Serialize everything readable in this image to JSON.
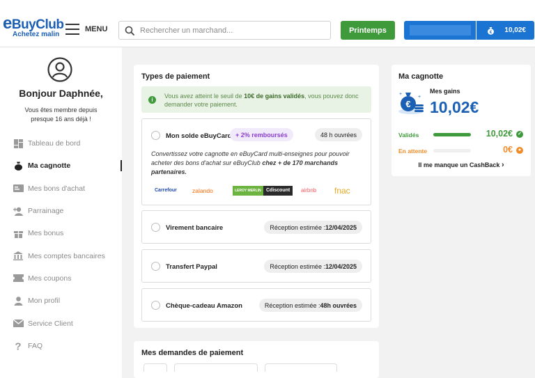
{
  "colors": {
    "brand": "#1b5fb5",
    "green": "#3f9a3c",
    "orange": "#f08c2a",
    "purple": "#8a3fd1"
  },
  "header": {
    "logo_main": "BuyClub",
    "logo_e": "e",
    "logo_tagline": "Achetez malin",
    "menu_label": "MENU",
    "search_placeholder": "Rechercher un marchand...",
    "promo_button": "Printemps",
    "balance": "10,02€"
  },
  "sidebar": {
    "greeting": "Bonjour Daphnée,",
    "member_text": "Vous êtes membre depuis presque 16 ans déjà !",
    "items": [
      {
        "label": "Tableau de bord",
        "icon": "dashboard-icon"
      },
      {
        "label": "Ma cagnotte",
        "icon": "money-bag-icon"
      },
      {
        "label": "Mes bons d'achat",
        "icon": "voucher-icon"
      },
      {
        "label": "Parrainage",
        "icon": "add-user-icon"
      },
      {
        "label": "Mes bonus",
        "icon": "gift-icon"
      },
      {
        "label": "Mes comptes bancaires",
        "icon": "bank-icon"
      },
      {
        "label": "Mes coupons",
        "icon": "coupon-icon"
      },
      {
        "label": "Mon profil",
        "icon": "user-icon"
      },
      {
        "label": "Service Client",
        "icon": "mail-icon"
      },
      {
        "label": "FAQ",
        "icon": "question-icon"
      }
    ],
    "active_index": 1
  },
  "payment": {
    "title": "Types de paiement",
    "info_pre": "Vous avez atteint le seuil de ",
    "info_bold": "10€ de gains validés",
    "info_post": ", vous pouvez donc demander votre paiement.",
    "options": [
      {
        "label": "Mon solde eBuyCard",
        "badge": "+ 2% remboursés",
        "pill": "48 h ouvrées",
        "desc_pre": "Convertissez votre cagnotte en eBuyCard multi-enseignes pour pouvoir acheter des bons d'achat sur eBuyClub ",
        "desc_bold": "chez + de 170 marchands partenaires.",
        "brands": [
          "Carrefour",
          "zalando",
          "LEROY MERLIN",
          "Cdiscount",
          "airbnb",
          "fnac"
        ]
      },
      {
        "label": "Virement bancaire",
        "pill": "Réception estimée : ",
        "pill_bold": "12/04/2025"
      },
      {
        "label": "Transfert Paypal",
        "pill": "Réception estimée : ",
        "pill_bold": "12/04/2025"
      },
      {
        "label": "Chèque-cadeau Amazon",
        "pill": "Réception estimée : ",
        "pill_bold": "48h ouvrées"
      }
    ]
  },
  "requests": {
    "title": "Mes demandes de paiement"
  },
  "wallet": {
    "title": "Ma cagnotte",
    "gains_label": "Mes gains",
    "gains_amount": "10,02€",
    "validated_label": "Validés",
    "validated_value": "10,02€",
    "validated_fraction": 1.0,
    "pending_label": "En attente",
    "pending_value": "0€",
    "pending_fraction": 0,
    "cashback_link": "Il me manque un CashBack"
  }
}
